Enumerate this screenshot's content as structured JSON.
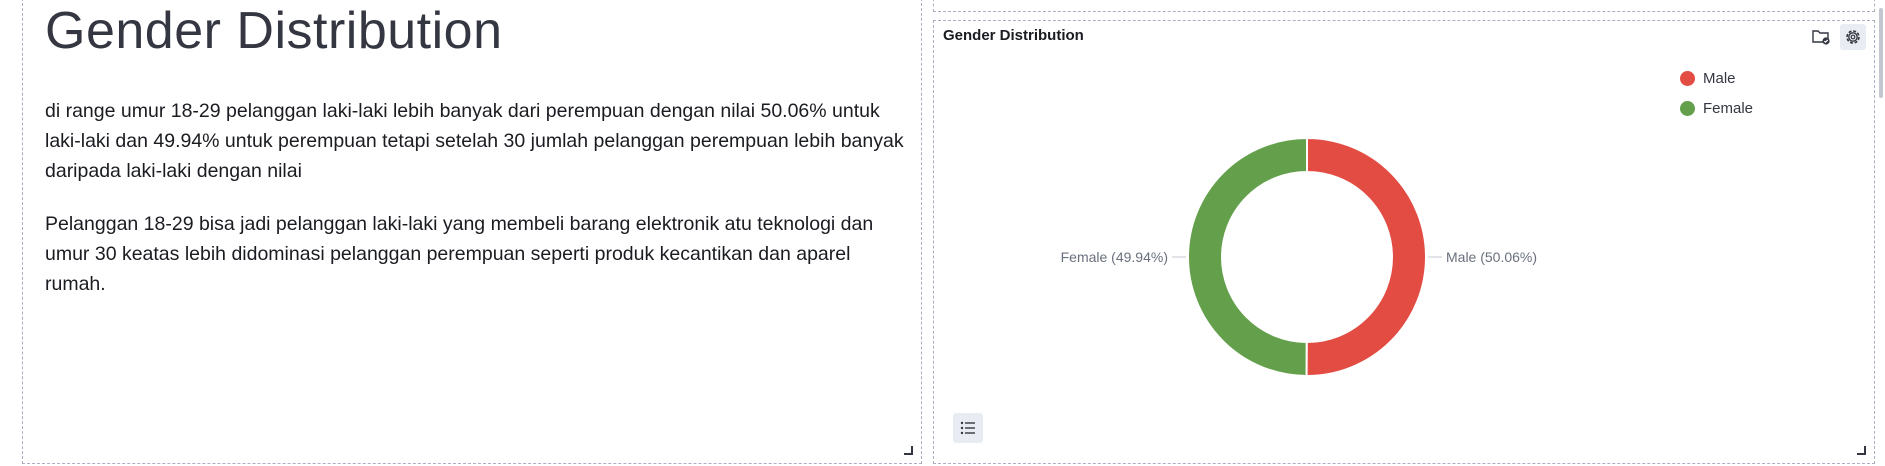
{
  "markdown_panel": {
    "title": "Gender Distribution",
    "paragraphs": [
      "di range umur 18-29 pelanggan laki-laki lebih banyak dari perempuan dengan nilai 50.06% untuk laki-laki dan 49.94% untuk perempuan tetapi setelah 30 jumlah pelanggan perempuan lebih banyak daripada laki-laki dengan nilai",
      "Pelanggan 18-29 bisa jadi pelanggan laki-laki yang membeli barang elektronik atu teknologi dan umur 30 keatas lebih didominasi pelanggan perempuan seperti produk kecantikan dan aparel rumah."
    ]
  },
  "vis_panel": {
    "title": "Gender Distribution",
    "icons": [
      "folder-check-icon",
      "gear-icon",
      "list-icon"
    ]
  },
  "chart_data": {
    "type": "pie",
    "donut": true,
    "slices": [
      {
        "label": "Male",
        "value": 50.06,
        "color": "#e34c43",
        "slice_label": "Male (50.06%)"
      },
      {
        "label": "Female",
        "value": 49.94,
        "color": "#64a04c",
        "slice_label": "Female (49.94%)"
      }
    ],
    "legend": {
      "position": "top-right",
      "entries": [
        "Male",
        "Female"
      ]
    }
  }
}
